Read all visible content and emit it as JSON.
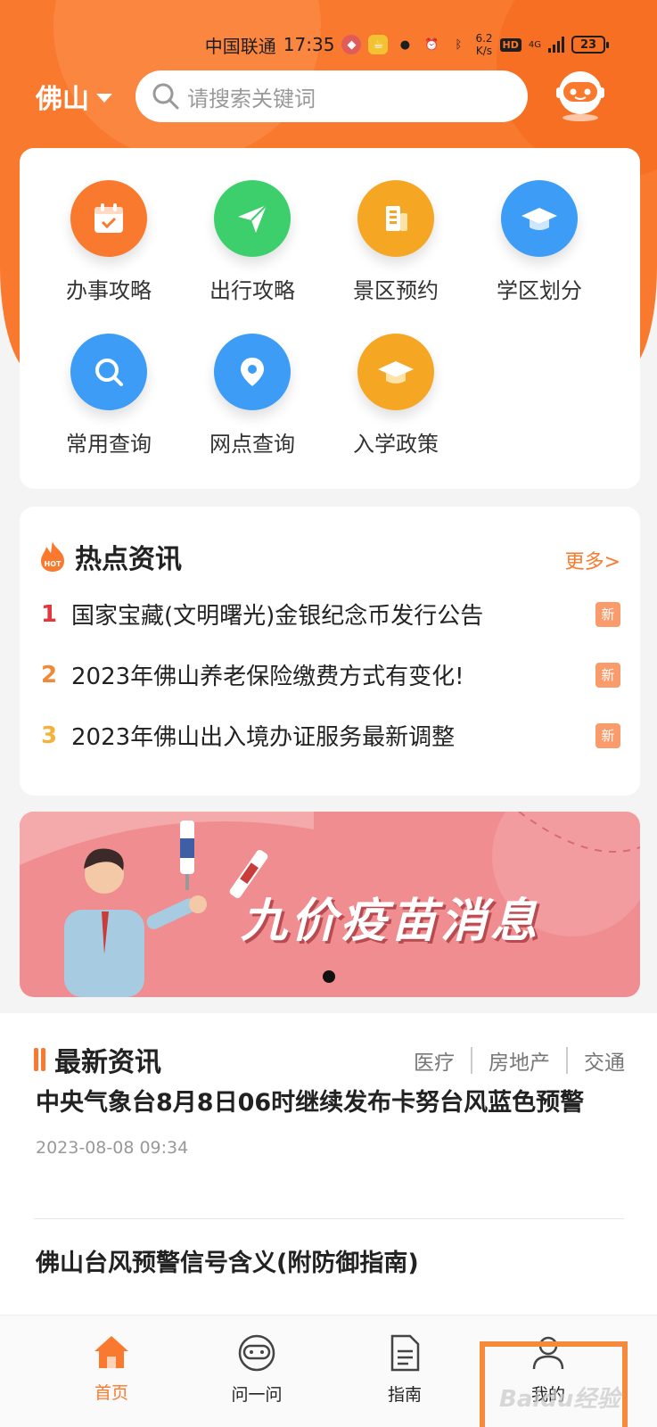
{
  "status_bar": {
    "carrier": "中国联通",
    "time": "17:35",
    "speed_value": "6.2",
    "speed_unit": "K/s",
    "hd": "HD",
    "network": "4G",
    "battery": "23"
  },
  "header": {
    "city": "佛山",
    "search_placeholder": "请搜索关键词"
  },
  "services": [
    {
      "label": "办事攻略",
      "color": "#f97a2e"
    },
    {
      "label": "出行攻略",
      "color": "#3ccf6b"
    },
    {
      "label": "景区预约",
      "color": "#f5a623"
    },
    {
      "label": "学区划分",
      "color": "#3d9cf5"
    },
    {
      "label": "常用查询",
      "color": "#3d9cf5"
    },
    {
      "label": "网点查询",
      "color": "#3d9cf5"
    },
    {
      "label": "入学政策",
      "color": "#f5a623"
    }
  ],
  "hot_news": {
    "title": "热点资讯",
    "more": "更多>",
    "badge": "新",
    "items": [
      {
        "rank": "1",
        "text": "国家宝藏(文明曙光)金银纪念币发行公告",
        "rank_color": "#e0383e"
      },
      {
        "rank": "2",
        "text": "2023年佛山养老保险缴费方式有变化!",
        "rank_color": "#f08a3a"
      },
      {
        "rank": "3",
        "text": "2023年佛山出入境办证服务最新调整",
        "rank_color": "#f5b23a"
      }
    ]
  },
  "banner": {
    "title": "九价疫苗消息"
  },
  "latest_news": {
    "title": "最新资讯",
    "categories": [
      "医疗",
      "房地产",
      "交通"
    ],
    "articles": [
      {
        "title": "中央气象台8月8日06时继续发布卡努台风蓝色预警",
        "time": "2023-08-08 09:34"
      },
      {
        "title": "佛山台风预警信号含义(附防御指南)"
      }
    ]
  },
  "bottom_nav": [
    {
      "label": "首页",
      "icon": "home-icon",
      "active": true
    },
    {
      "label": "问一问",
      "icon": "robot-icon",
      "active": false
    },
    {
      "label": "指南",
      "icon": "document-icon",
      "active": false
    },
    {
      "label": "我的",
      "icon": "user-icon",
      "active": false
    }
  ],
  "watermark": "Baidu经验",
  "colors": {
    "brand": "#f97a2e"
  }
}
